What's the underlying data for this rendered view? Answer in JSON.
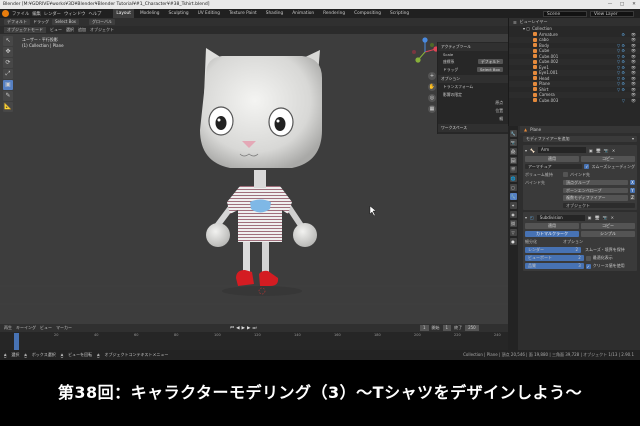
{
  "window": {
    "title": "Blender [M:¥GDRIVE¥works¥3D¥Blender¥Blender Tutorial¥#1_Character¥#38_Tshirt.blend]",
    "controls": [
      "—",
      "□",
      "✕"
    ]
  },
  "topbar": {
    "menus": [
      "ファイル",
      "編集",
      "レンダー",
      "ウィンドウ",
      "ヘルプ"
    ],
    "workspaces": [
      "Layout",
      "Modeling",
      "Sculpting",
      "UV Editing",
      "Texture Paint",
      "Shading",
      "Animation",
      "Rendering",
      "Compositing",
      "Scripting"
    ],
    "active_workspace": "Layout",
    "scene_label": "Scene",
    "view_layer_label": "View Layer"
  },
  "viewport_tools": {
    "mode": "オブジェクトモード",
    "view": "ビュー",
    "select": "選択",
    "add": "追加",
    "object": "オブジェクト",
    "orientation": "デフォルト",
    "drag": "ドラッグ",
    "select_box": "Select Box",
    "global": "グローバル"
  },
  "viewport_info": {
    "line1": "ユーザー・平行投影",
    "line2": "(1) Collection | Plane"
  },
  "tools": [
    "↖",
    "✥",
    "⟳",
    "⤢",
    "▣",
    "✎",
    "📐"
  ],
  "npanel": {
    "active_tool_title": "アクティブツール",
    "scale_label": "Scale",
    "options_label": "座標系",
    "options_value": "デフォルト",
    "drag_label": "ドラッグ",
    "drag_value": "Select Box",
    "options_title": "オプション",
    "transform_label": "トランスフォーム",
    "affect_only": "影響の限定",
    "origins": "原点",
    "locations": "位置",
    "parents": "親",
    "workspace_title": "ワークスペース",
    "tabs": [
      "アイテム",
      "ツール",
      "ビュー"
    ]
  },
  "outliner": {
    "header": "ビューレイヤー",
    "collection": "Collection",
    "items": [
      {
        "name": "Armature",
        "mods": "⚙"
      },
      {
        "name": "cabo",
        "mods": ""
      },
      {
        "name": "Body",
        "mods": "▽ ⚙"
      },
      {
        "name": "Cube",
        "mods": "▽ ⚙"
      },
      {
        "name": "Cube.001",
        "mods": "▽ ⚙"
      },
      {
        "name": "Cube.002",
        "mods": "▽ ⚙"
      },
      {
        "name": "Eye1",
        "mods": "▽ ⚙"
      },
      {
        "name": "Eye1.001",
        "mods": "▽ ⚙"
      },
      {
        "name": "Head",
        "mods": "▽ ⚙"
      },
      {
        "name": "Plane",
        "mods": "▽ ⚙"
      },
      {
        "name": "Shirt",
        "mods": "▽ ⚙"
      },
      {
        "name": "Camera",
        "mods": ""
      },
      {
        "name": "Cube.003",
        "mods": "▽"
      }
    ]
  },
  "properties": {
    "object_name": "Plane",
    "add_modifier": "モディファイアーを追加",
    "mod1": {
      "name": "Arm",
      "apply": "適用",
      "copy": "コピー",
      "armature_field": "アーマチュア",
      "preserve_volume": "ボリューム維持",
      "multi_modifier": "複数モディファイアー",
      "vertex_groups": "頂点グループ",
      "bind_to": "バインド先",
      "envelope": "エンベロープ",
      "vg_check": "✕",
      "bone_env": "ボーンエンベロープ",
      "mod_x": "X",
      "mod_y": "Y",
      "mod_z": "Z",
      "env_label": "オブジェクト",
      "smooth_shading": "スムーズシェーディング",
      "invert": "反転"
    },
    "mod2": {
      "name": "Subdivision",
      "apply": "適用",
      "copy": "コピー",
      "catmull": "カトマルクラーク",
      "simple": "シンプル",
      "subdiv_title": "細分化",
      "render_label": "レンダー",
      "render_value": "2",
      "viewport_label": "ビューポート",
      "viewport_value": "2",
      "quality_label": "品質",
      "quality_value": "3",
      "options_title": "オプション",
      "smooth_uv": "スムーズ・境界を保持",
      "optimal_display": "最適化表示",
      "crease": "クリース値を使用"
    }
  },
  "timeline": {
    "menus": [
      "再生",
      "キーイング",
      "ビュー",
      "マーカー"
    ],
    "start_label": "開始",
    "start_value": "1",
    "end_label": "終了",
    "end_value": "250",
    "current_frame": "1",
    "ruler": [
      "0",
      "20",
      "40",
      "60",
      "80",
      "100",
      "120",
      "140",
      "160",
      "180",
      "200",
      "220",
      "240"
    ]
  },
  "statusbar": {
    "select": "選択",
    "box_select": "ボックス選択",
    "rotate_view": "ビューを回転",
    "context_menu": "オブジェクトコンテキストメニュー",
    "stats": "Collection | Plane | 頂点 20,546 | 面 19,880 | 三角面 39,728 | オブジェクト 1/13 | 2.90.1"
  },
  "caption": "第38回：キャラクターモデリング（3）〜Tシャツをデザインしよう〜",
  "colors": {
    "accent": "#4772b3",
    "blender_orange": "#e87d0d",
    "shoe_red": "#d41c22",
    "pocket_blue": "#7fb8e6"
  }
}
